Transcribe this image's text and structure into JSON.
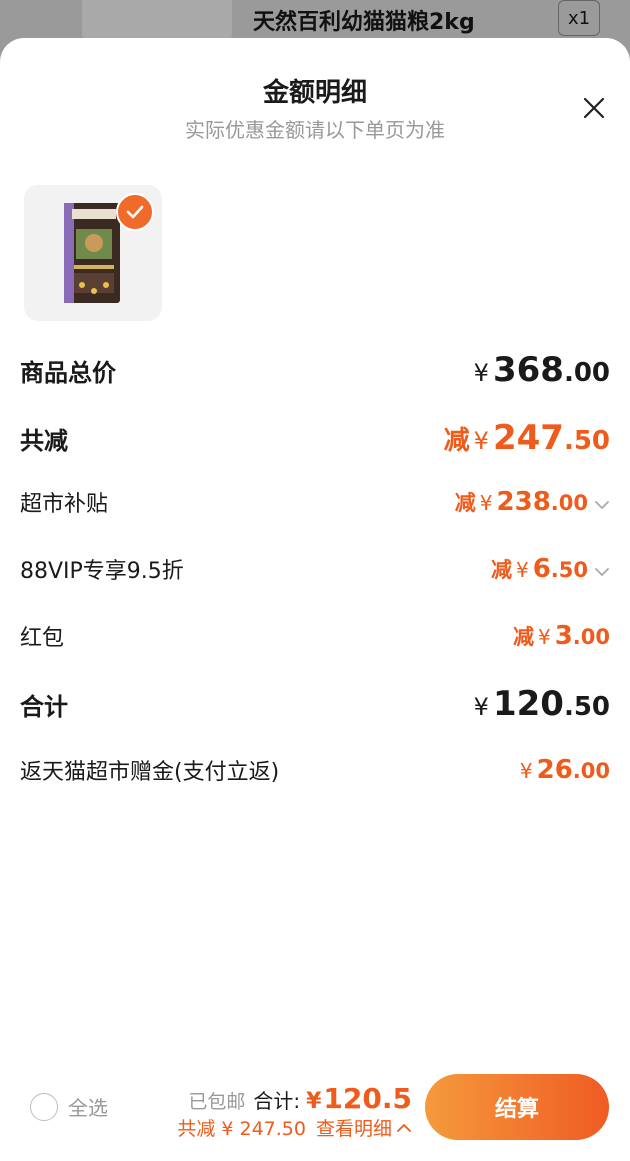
{
  "background": {
    "product_title": "天然百利幼猫猫粮2kg",
    "quantity": "x1"
  },
  "sheet": {
    "title": "金额明细",
    "subtitle": "实际优惠金额请以下单页为准",
    "close_icon": "close-icon"
  },
  "product": {
    "image_icon": "cat-food-bag-image",
    "selected": true
  },
  "rows": {
    "total_price": {
      "label": "商品总价",
      "currency": "¥",
      "int": "368",
      "dec": ".00"
    },
    "total_discount": {
      "label": "共减",
      "prefix": "减",
      "currency": "¥",
      "int": "247",
      "dec": ".50"
    },
    "supermarket_subsidy": {
      "label": "超市补贴",
      "prefix": "减",
      "currency": "¥",
      "int": "238",
      "dec": ".00"
    },
    "vip_discount": {
      "label": "88VIP专享9.5折",
      "prefix": "减",
      "currency": "¥",
      "int": "6",
      "dec": ".50"
    },
    "red_packet": {
      "label": "红包",
      "prefix": "减",
      "currency": "¥",
      "int": "3",
      "dec": ".00"
    },
    "subtotal": {
      "label": "合计",
      "currency": "¥",
      "int": "120",
      "dec": ".50"
    },
    "cashback": {
      "label": "返天猫超市赠金(支付立返)",
      "currency": "¥",
      "int": "26",
      "dec": ".00"
    }
  },
  "bottom_bar": {
    "select_all": "全选",
    "shipping": "已包邮",
    "total_label": "合计:",
    "total_currency": "¥",
    "total_value": "120.5",
    "saving": "共减 ¥ 247.50",
    "detail_link": "查看明细",
    "checkout": "结算"
  },
  "colors": {
    "accent": "#ee5b1a",
    "button_gradient_start": "#f59a3c",
    "button_gradient_end": "#ef5b23"
  }
}
